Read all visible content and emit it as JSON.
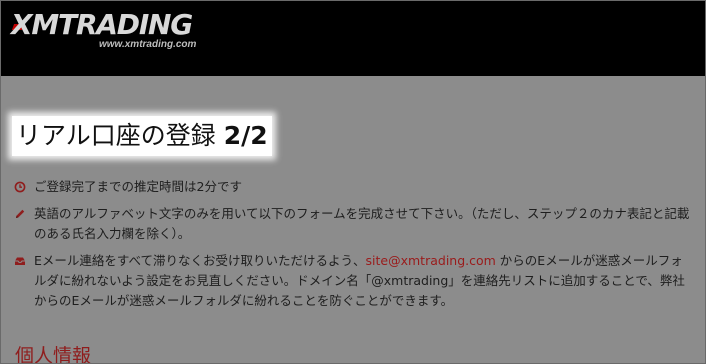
{
  "header": {
    "logo_text": "XMTRADING",
    "logo_url_text": "www.xmtrading.com"
  },
  "page": {
    "title": "リアル口座の登録",
    "step": "2/2"
  },
  "notes": {
    "time": "ご登録完了までの推定時間は2分です",
    "english": "英語のアルファベット文字のみを用いて以下のフォームを完成させて下さい。（ただし、ステップ２のカナ表記と記載のある氏名入力欄を除く）。",
    "email_before": "Eメール連絡をすべて滞りなくお受け取りいただけるよう、",
    "email_link": "site@xmtrading.com",
    "email_after": " からのEメールが迷惑メールフォルダに紛れないよう設定をお見直しください。ドメイン名「@xmtrading」を連絡先リストに追加することで、弊社からのEメールが迷惑メールフォルダに紛れることを防ぐことができます。"
  },
  "section": {
    "personal_info": "個人情報"
  },
  "colors": {
    "overlay_bg": "#8c8c8c",
    "header_bg": "#000000",
    "accent_red": "#9a1b1b"
  },
  "icons": {
    "time": "clock-icon",
    "english": "pencil-icon",
    "email": "envelope-icon"
  }
}
